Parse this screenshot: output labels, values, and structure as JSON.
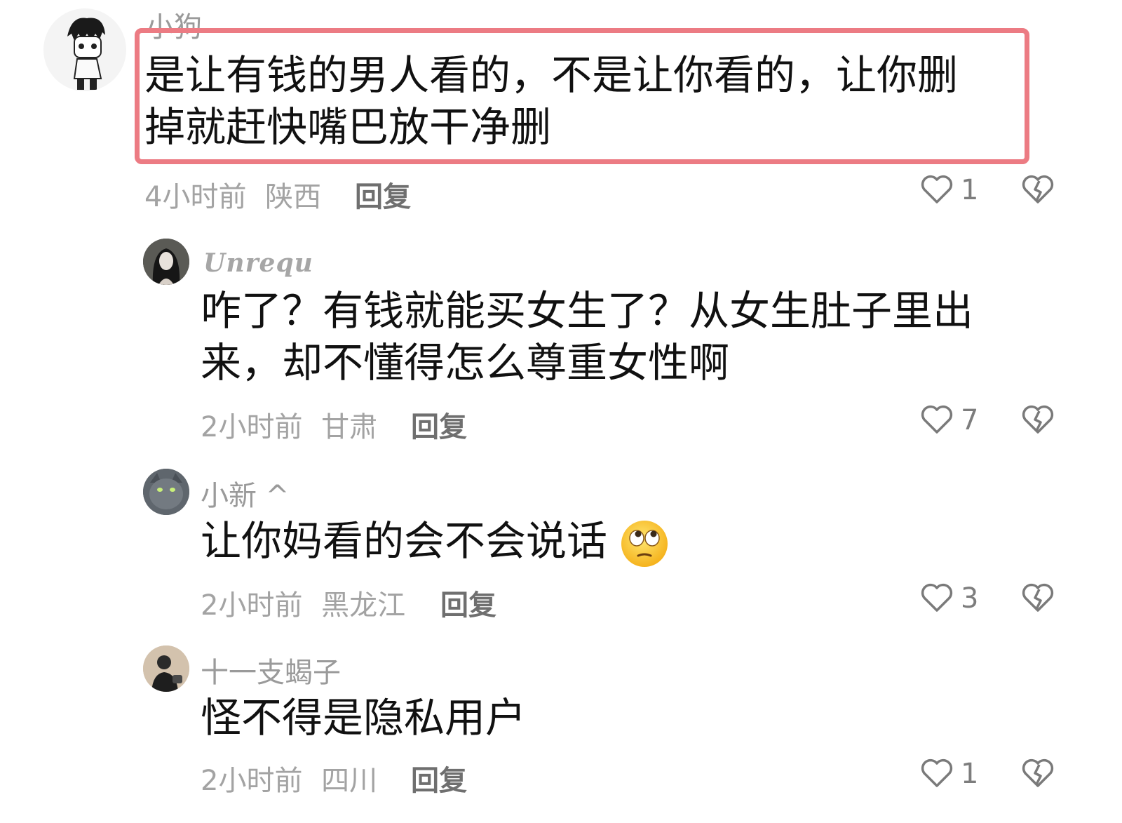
{
  "comments": [
    {
      "username": "小狗",
      "avatar": "cartoon-boy-avatar",
      "text_lines": [
        "是让有钱的男人看的，不是让你看的，让你删",
        "掉就赶快嘴巴放干净删"
      ],
      "time": "4小时前",
      "location": "陕西",
      "reply_label": "回复",
      "likes": "1",
      "highlighted": true
    },
    {
      "username": "Unrequ",
      "avatar": "girl-photo-avatar",
      "text_lines": [
        "咋了？有钱就能买女生了？从女生肚子里出",
        "来，却不懂得怎么尊重女性啊"
      ],
      "time": "2小时前",
      "location": "甘肃",
      "reply_label": "回复",
      "likes": "7"
    },
    {
      "username": "小新 ^",
      "avatar": "cat-photo-avatar",
      "text_lines": [
        "让你妈看的会不会说话"
      ],
      "emoji": "eye-roll-emoji",
      "time": "2小时前",
      "location": "黑龙江",
      "reply_label": "回复",
      "likes": "3"
    },
    {
      "username": "十一支蝎子",
      "avatar": "person-photo-avatar",
      "text_lines": [
        "怪不得是隐私用户"
      ],
      "time": "2小时前",
      "location": "四川",
      "reply_label": "回复",
      "likes": "1"
    }
  ],
  "colors": {
    "highlight_border": "#ec7b83",
    "meta_text": "#a3a3a3",
    "body_text": "#111111"
  }
}
